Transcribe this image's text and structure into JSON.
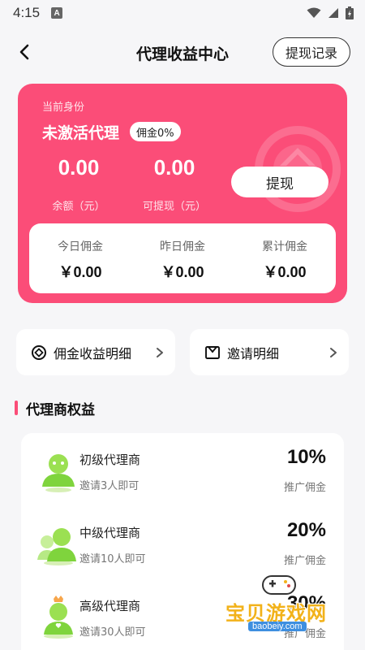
{
  "status_bar": {
    "time": "4:15",
    "notif_letter": "A"
  },
  "header": {
    "title": "代理收益中心",
    "record_button": "提现记录"
  },
  "card": {
    "identity_label": "当前身份",
    "identity_name": "未激活代理",
    "commission_rate_badge": "佣金0%",
    "balance": {
      "value": "0.00",
      "label": "余额（元）"
    },
    "withdrawable": {
      "value": "0.00",
      "label": "可提现（元）"
    },
    "withdraw_button": "提现",
    "commissions": [
      {
        "label": "今日佣金",
        "value": "￥0.00"
      },
      {
        "label": "昨日佣金",
        "value": "￥0.00"
      },
      {
        "label": "累计佣金",
        "value": "￥0.00"
      }
    ],
    "accent_color": "#fb4d78"
  },
  "links": [
    {
      "label": "佣金收益明细",
      "icon": "commission-detail-icon"
    },
    {
      "label": "邀请明细",
      "icon": "invite-mail-icon"
    }
  ],
  "section": {
    "title": "代理商权益"
  },
  "tiers": [
    {
      "name": "初级代理商",
      "condition": "邀请3人即可",
      "rate": "10%",
      "rate_label": "推广佣金",
      "icon": "agent-avatar-icon"
    },
    {
      "name": "中级代理商",
      "condition": "邀请10人即可",
      "rate": "20%",
      "rate_label": "推广佣金",
      "icon": "agent-group-icon"
    },
    {
      "name": "高级代理商",
      "condition": "邀请30人即可",
      "rate": "30%",
      "rate_label": "推广佣金",
      "icon": "agent-crown-icon"
    }
  ],
  "watermark": {
    "text": "宝贝游戏网",
    "url": "baobeiy.com"
  }
}
